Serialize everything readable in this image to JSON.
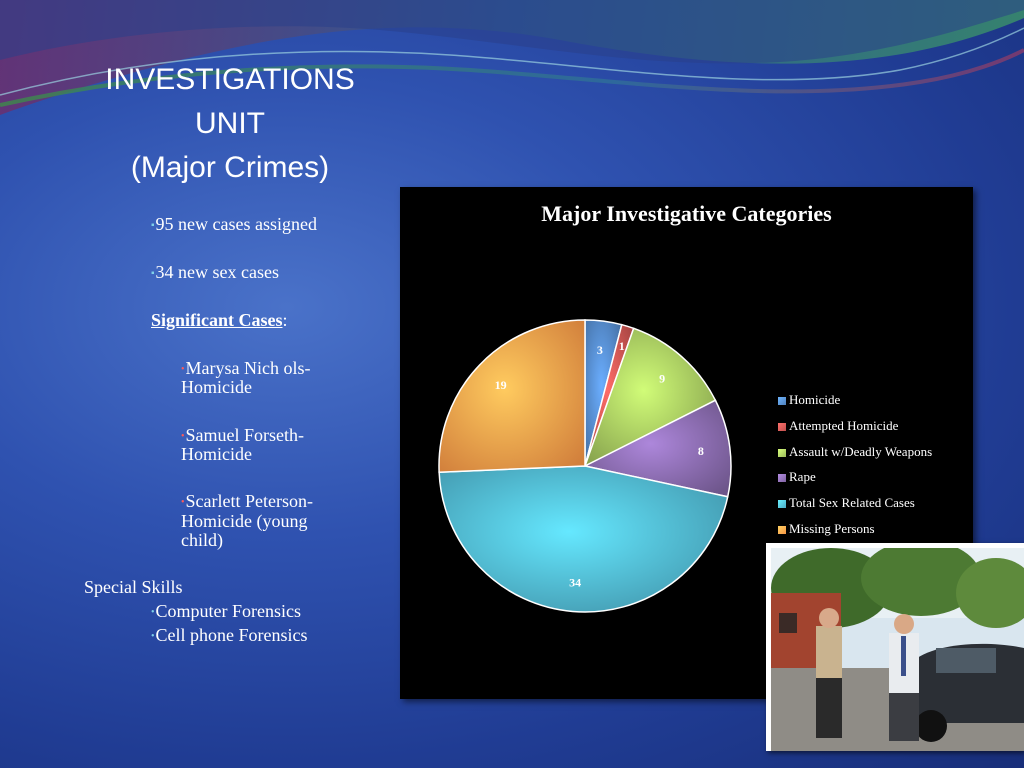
{
  "slide": {
    "title_lines": [
      "INVESTIGATIONS",
      "UNIT",
      "(Major Crimes)"
    ],
    "bullets": {
      "new_cases": "95 new cases assigned",
      "sex_cases": "34 new sex cases",
      "significant_label": "Significant Cases",
      "significant_colon": ":",
      "case1_line1": "Marysa Nich ols-",
      "case1_line2": "Homicide",
      "case2_line1": "Samuel Forseth-",
      "case2_line2": "Homicide",
      "case3_line1": "Scarlett Peterson-",
      "case3_line2": "Homicide (young",
      "case3_line3": "child)",
      "special_skills": "Special Skills",
      "skill1": "Computer Forensics",
      "skill2": "Cell phone Forensics"
    },
    "bullet_marker": "▪",
    "sub_marker": "•"
  },
  "chart_data": {
    "type": "pie",
    "title": "Major Investigative Categories",
    "categories": [
      "Homicide",
      "Attempted Homicide",
      "Assault w/Deadly Weapons",
      "Rape",
      "Total Sex Related Cases",
      "Missing Persons"
    ],
    "values": [
      3,
      1,
      9,
      8,
      34,
      19
    ],
    "colors": [
      "#4f81bd",
      "#c0504d",
      "#9bbb59",
      "#8064a2",
      "#4bacc6",
      "#f79646"
    ],
    "data_labels": [
      "3",
      "1",
      "9",
      "8",
      "34",
      "19"
    ],
    "legend_position": "right"
  },
  "photo": {
    "alt": "Two investigators standing beside a car"
  }
}
